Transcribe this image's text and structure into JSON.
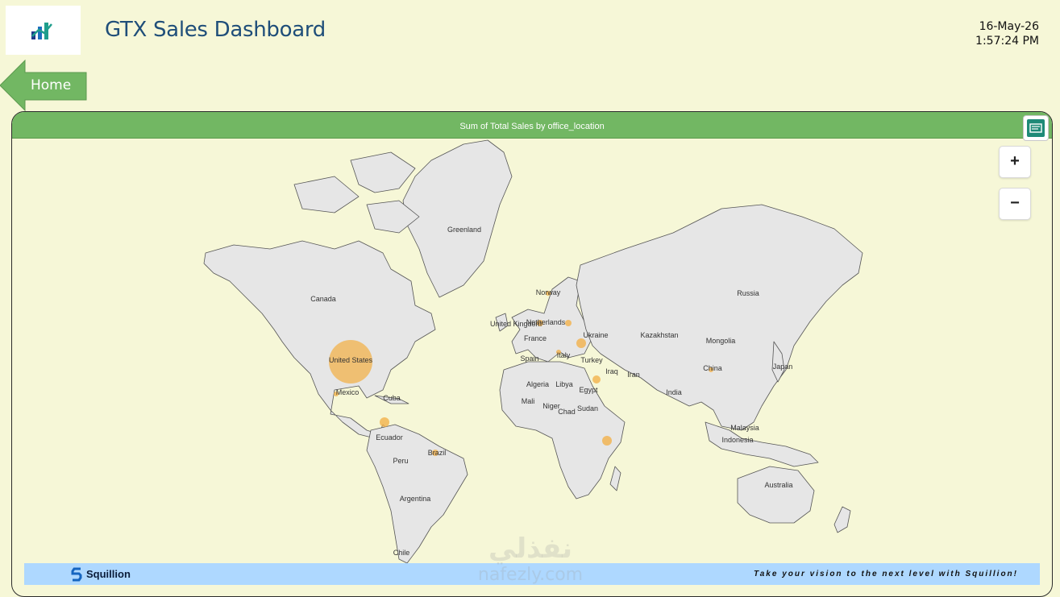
{
  "header": {
    "title": "GTX Sales Dashboard",
    "date": "16-May-26",
    "time": "1:57:24 PM"
  },
  "nav": {
    "home_label": "Home"
  },
  "map_panel": {
    "title": "Sum of Total Sales by office_location",
    "zoom_in_label": "+",
    "zoom_out_label": "−",
    "bubble_color": "#f2b14b",
    "country_labels": [
      "Greenland",
      "Canada",
      "United States",
      "Mexico",
      "Cuba",
      "Ecuador",
      "Peru",
      "Brazil",
      "Argentina",
      "Chile",
      "Norway",
      "United Kingdom",
      "Netherlands",
      "France",
      "Spain",
      "Italy",
      "Ukraine",
      "Turkey",
      "Kazakhstan",
      "Mongolia",
      "Russia",
      "Iran",
      "Iraq",
      "India",
      "China",
      "Japan",
      "Algeria",
      "Libya",
      "Egypt",
      "Mali",
      "Niger",
      "Chad",
      "Sudan",
      "Malaysia",
      "Indonesia",
      "Australia"
    ],
    "office_bubbles": [
      {
        "location": "United States",
        "relative_size": 1.0
      },
      {
        "location": "Ukraine",
        "relative_size": 0.2
      },
      {
        "location": "Turkey",
        "relative_size": 0.18
      },
      {
        "location": "Costa Rica",
        "relative_size": 0.2
      },
      {
        "location": "Kenya",
        "relative_size": 0.2
      },
      {
        "location": "Brazil",
        "relative_size": 0.15
      },
      {
        "location": "Netherlands",
        "relative_size": 0.15
      },
      {
        "location": "Norway",
        "relative_size": 0.12
      },
      {
        "location": "Poland",
        "relative_size": 0.15
      },
      {
        "location": "Italy",
        "relative_size": 0.12
      },
      {
        "location": "China",
        "relative_size": 0.12
      },
      {
        "location": "Mexico",
        "relative_size": 0.12
      }
    ]
  },
  "footer": {
    "brand": "Squillion",
    "tagline": "Take your vision to the next level with Squillion!"
  },
  "watermark": {
    "arabic": "نفذلي",
    "latin": "nafezly.com"
  },
  "colors": {
    "background": "#f6f7d7",
    "title_blue": "#1f4e79",
    "header_green": "#72b763",
    "footer_blue": "#aed8ff",
    "land": "#e6e6e6",
    "border": "#555555"
  }
}
